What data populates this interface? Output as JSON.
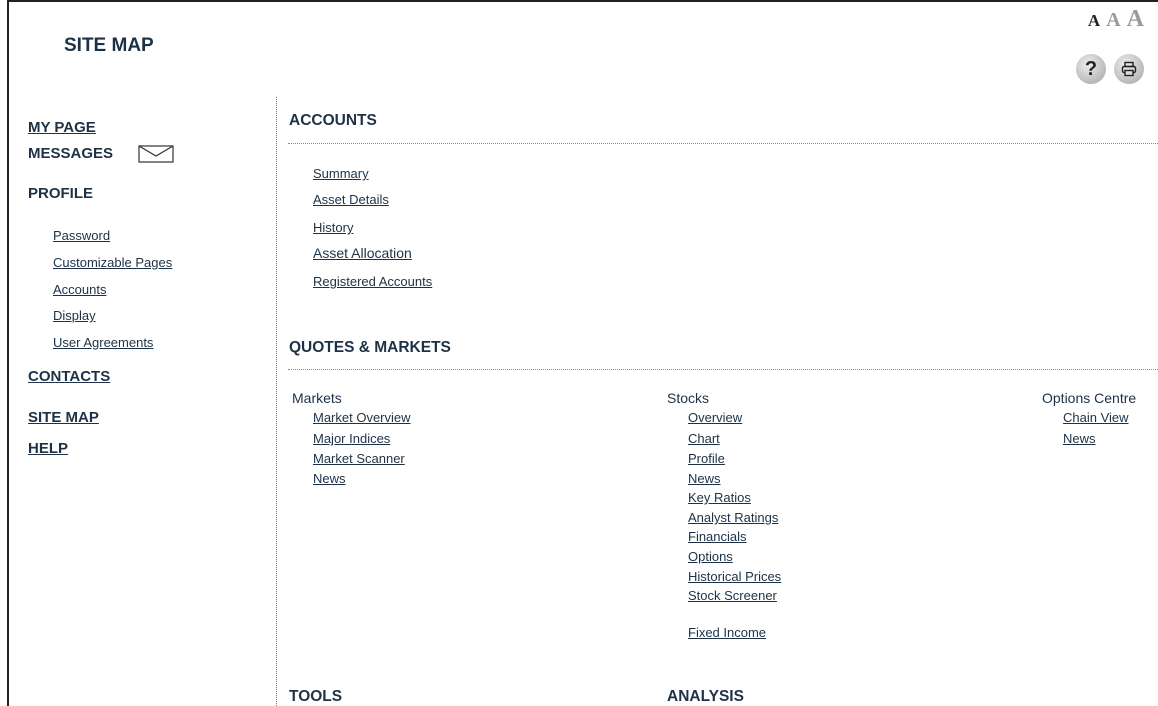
{
  "page": {
    "title": "SITE MAP"
  },
  "toolbar": {
    "font_small": "A",
    "font_medium": "A",
    "font_large": "A",
    "help_label": "?"
  },
  "sidebar": {
    "my_page": "MY PAGE",
    "messages": "MESSAGES",
    "profile": "PROFILE",
    "profile_items": [
      "Password",
      "Customizable Pages",
      "Accounts",
      "Display",
      "User Agreements"
    ],
    "contacts": "CONTACTS",
    "site_map": "SITE MAP",
    "help": "HELP"
  },
  "accounts": {
    "title": "ACCOUNTS",
    "links": [
      "Summary",
      "Asset Details",
      "History",
      "Asset Allocation",
      "Registered Accounts"
    ]
  },
  "quotes": {
    "title": "QUOTES & MARKETS",
    "markets": {
      "heading": "Markets",
      "links": [
        "Market Overview",
        "Major Indices",
        "Market Scanner",
        "News"
      ]
    },
    "stocks": {
      "heading": "Stocks",
      "links": [
        "Overview",
        "Chart",
        "Profile",
        "News",
        "Key Ratios",
        "Analyst Ratings",
        "Financials",
        "Options",
        "Historical Prices",
        "Stock Screener"
      ],
      "fixed_income": "Fixed Income"
    },
    "options": {
      "heading": "Options Centre",
      "links": [
        "Chain View",
        "News"
      ]
    }
  },
  "tools": {
    "title": "TOOLS"
  },
  "analysis": {
    "title": "ANALYSIS"
  },
  "colors": {
    "text": "#1d3246",
    "rule": "#888888"
  }
}
